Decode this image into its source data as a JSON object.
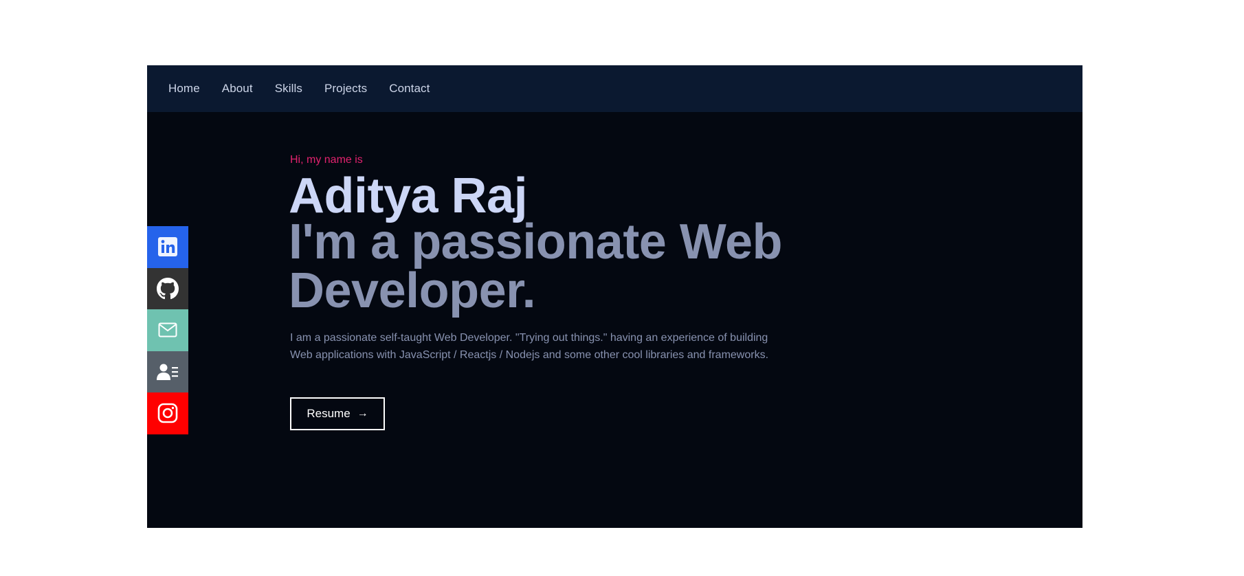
{
  "nav": {
    "items": [
      {
        "label": "Home"
      },
      {
        "label": "About"
      },
      {
        "label": "Skills"
      },
      {
        "label": "Projects"
      },
      {
        "label": "Contact"
      }
    ]
  },
  "social": {
    "items": [
      {
        "icon": "linkedin-icon",
        "color": "#2563eb"
      },
      {
        "icon": "github-icon",
        "color": "#333333"
      },
      {
        "icon": "mail-icon",
        "color": "#6fc2b0"
      },
      {
        "icon": "contact-card-icon",
        "color": "#565f69"
      },
      {
        "icon": "instagram-icon",
        "color": "#ff0000"
      }
    ]
  },
  "hero": {
    "greeting": "Hi, my name is",
    "name": "Aditya Raj",
    "tagline": "I'm a passionate Web Developer.",
    "bio": "I am a passionate self-taught Web Developer. \"Trying out things.\" having an experience of building Web applications with JavaScript / Reactjs / Nodejs and some other cool libraries and frameworks.",
    "resume_label": "Resume",
    "resume_arrow": "→"
  },
  "colors": {
    "nav_bg": "#0b1930",
    "page_bg": "#040811",
    "accent": "#e2226e",
    "name": "#ccd6f6",
    "muted": "#8892b0"
  }
}
